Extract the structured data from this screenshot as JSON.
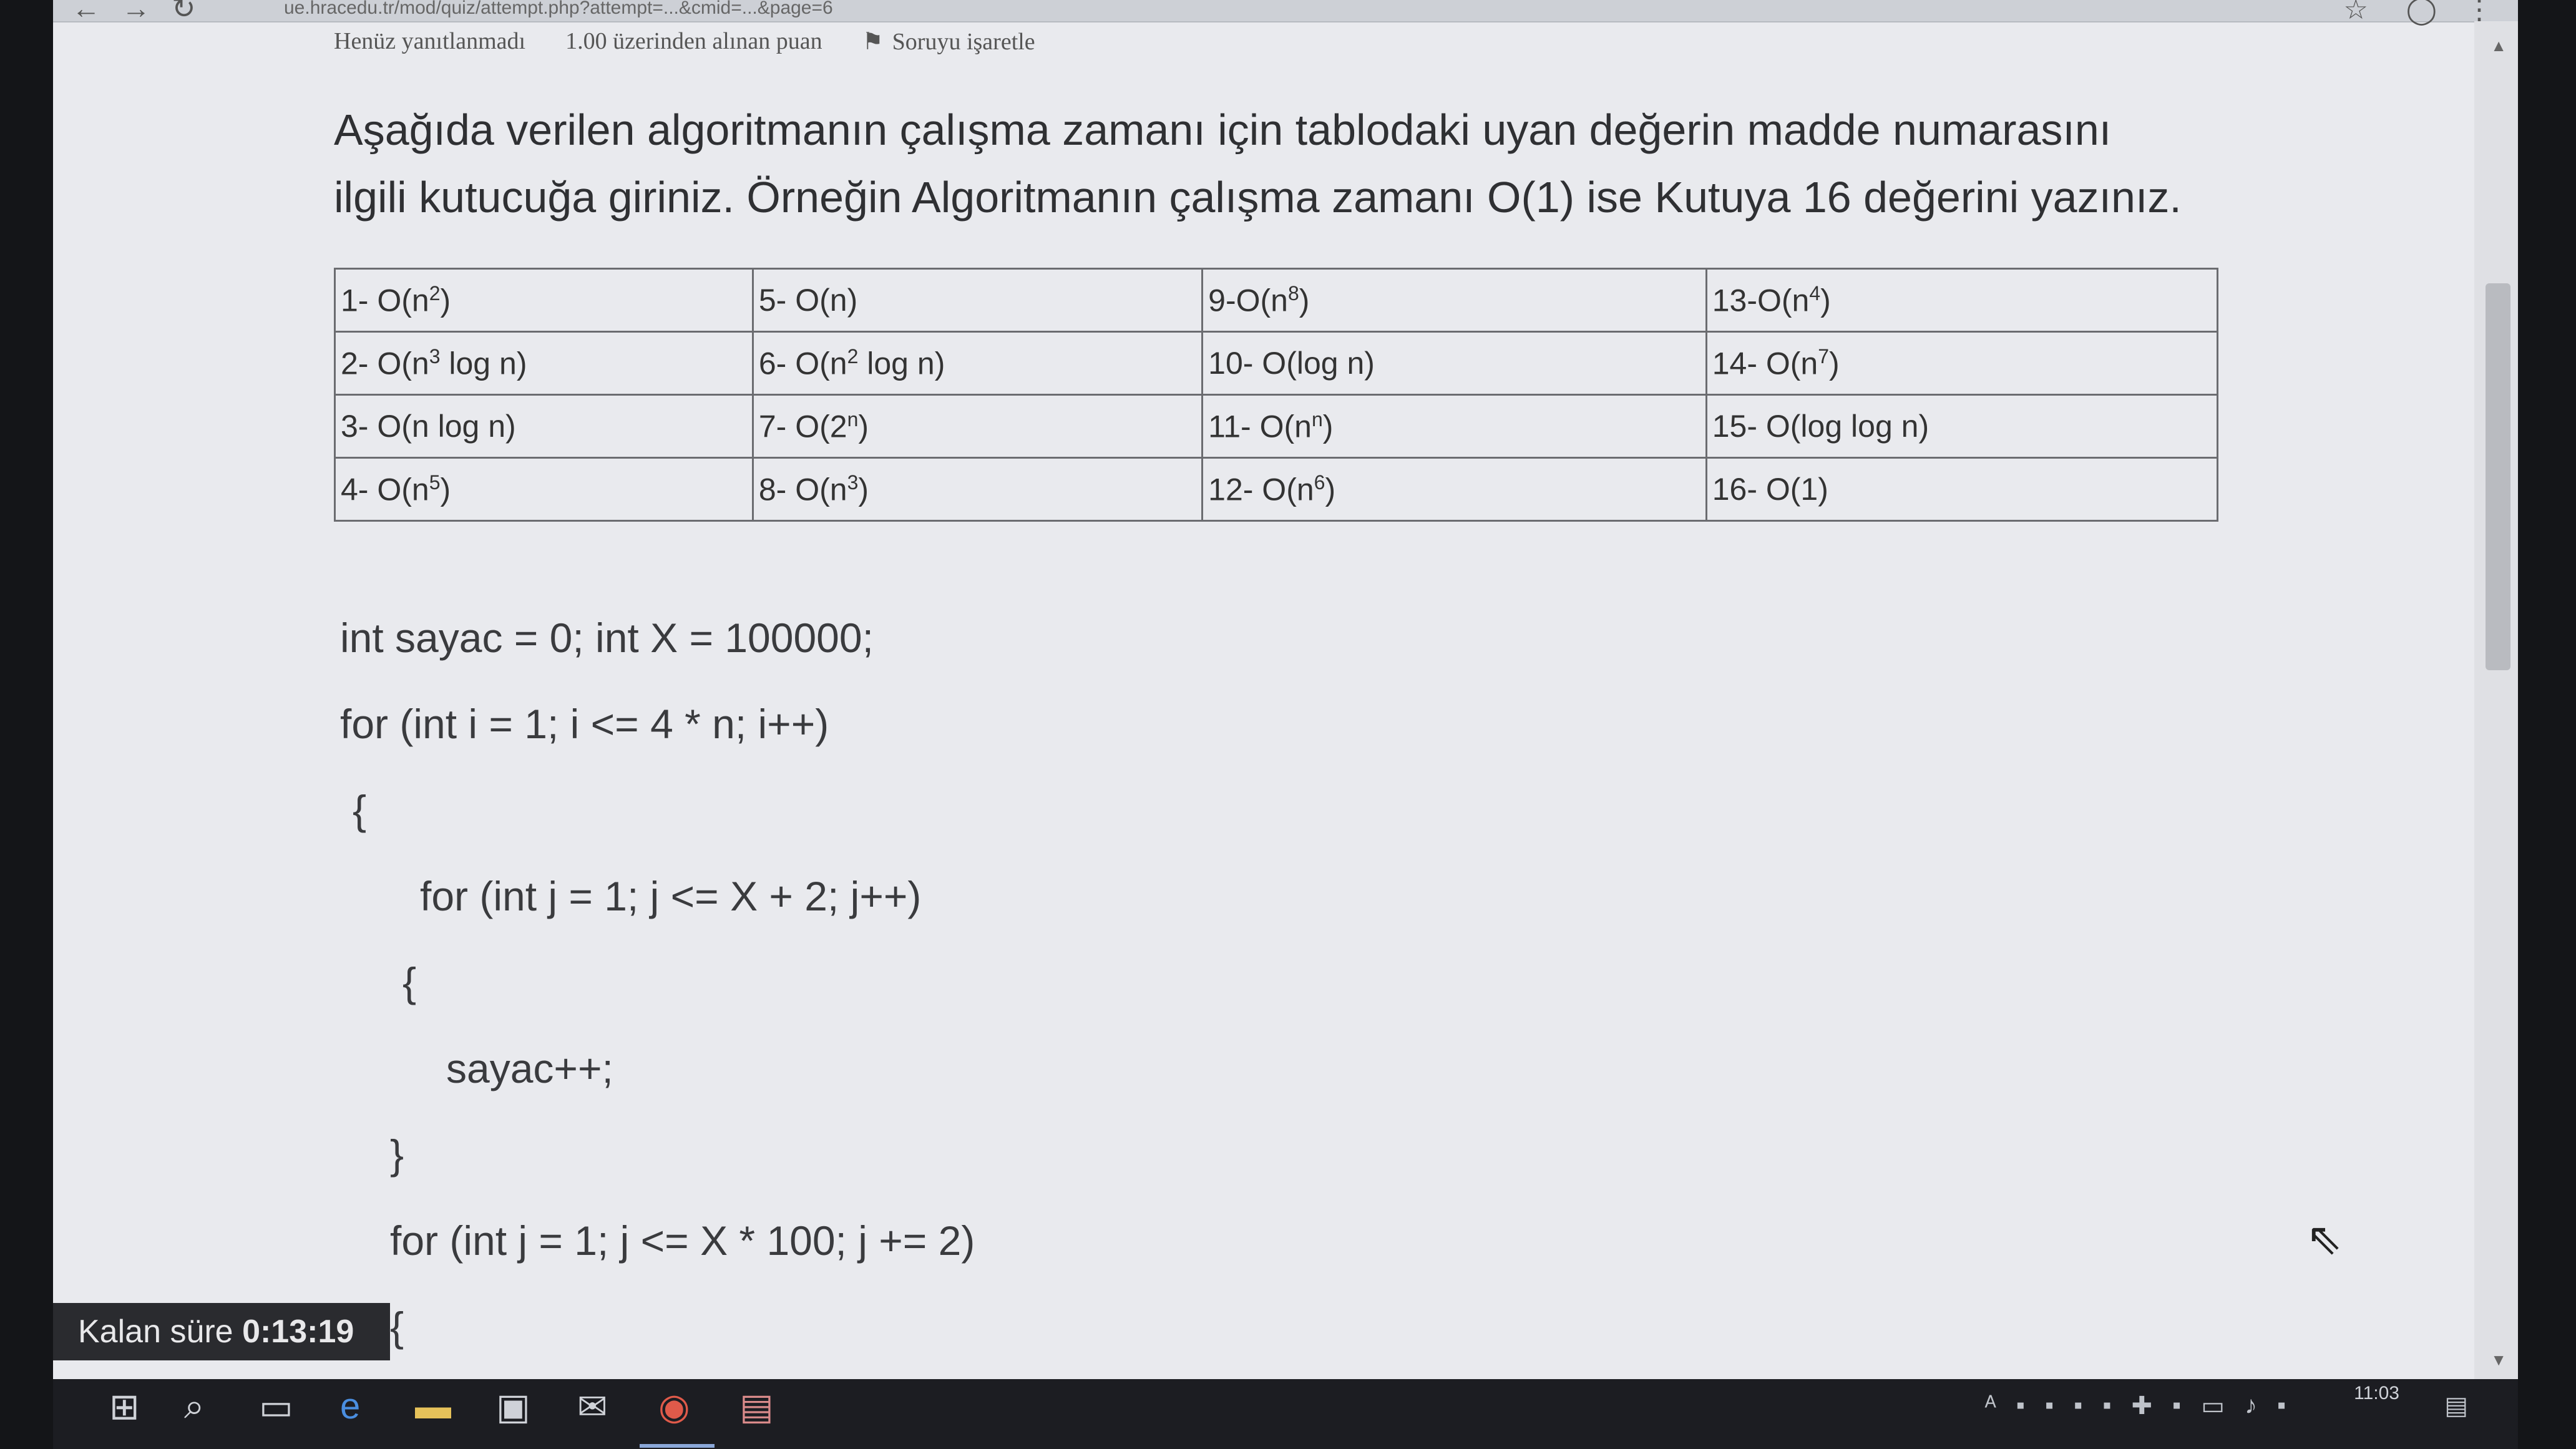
{
  "browser": {
    "url_partial": "ue.hracedu.tr/mod/quiz/attempt.php?attempt=...&cmid=...&page=6"
  },
  "info_bar": {
    "status": "Henüz yanıtlanmadı",
    "points": "1.00 üzerinden alınan puan",
    "flag_label": "Soruyu işaretle"
  },
  "question": {
    "line1": "Aşağıda verilen algoritmanın çalışma zamanı için tablodaki uyan değerin madde numarasını",
    "line2": "ilgili kutucuğa giriniz. Örneğin Algoritmanın çalışma zamanı O(1) ise Kutuya 16 değerini yazınız."
  },
  "table": {
    "rows": [
      [
        {
          "pre": "1- O(n",
          "sup": "2",
          "post": ")"
        },
        {
          "pre": "5- O(n)",
          "sup": "",
          "post": ""
        },
        {
          "pre": "9-O(n",
          "sup": "8",
          "post": ")"
        },
        {
          "pre": "13-O(n",
          "sup": "4",
          "post": ")"
        }
      ],
      [
        {
          "pre": "2- O(n",
          "sup": "3",
          "post": " log n)"
        },
        {
          "pre": "6- O(n",
          "sup": "2",
          "post": " log n)"
        },
        {
          "pre": "10- O(log n)",
          "sup": "",
          "post": ""
        },
        {
          "pre": "14- O(n",
          "sup": "7",
          "post": ")"
        }
      ],
      [
        {
          "pre": "3- O(n log n)",
          "sup": "",
          "post": ""
        },
        {
          "pre": "7- O(2",
          "sup": "n",
          "post": ")"
        },
        {
          "pre": "11- O(n",
          "sup": "n",
          "post": ")"
        },
        {
          "pre": "15- O(log log n)",
          "sup": "",
          "post": ""
        }
      ],
      [
        {
          "pre": "4- O(n",
          "sup": "5",
          "post": ")"
        },
        {
          "pre": "8- O(n",
          "sup": "3",
          "post": ")"
        },
        {
          "pre": "12- O(n",
          "sup": "6",
          "post": ")"
        },
        {
          "pre": "16- O(1)",
          "sup": "",
          "post": ""
        }
      ]
    ]
  },
  "code": {
    "l1": "int sayac = 0; int X = 100000;",
    "l2": "for (int i = 1; i <= 4 * n; i++)",
    "l3": "{",
    "l4": "for (int j = 1; j <= X + 2; j++)",
    "l5": "{",
    "l6": "sayac++;",
    "l7": "}",
    "l8": "for (int j = 1; j <= X * 100; j += 2)",
    "l9": "{"
  },
  "timer": {
    "label": "Kalan süre",
    "value": "0:13:19"
  },
  "clock": {
    "time": "11:03"
  }
}
